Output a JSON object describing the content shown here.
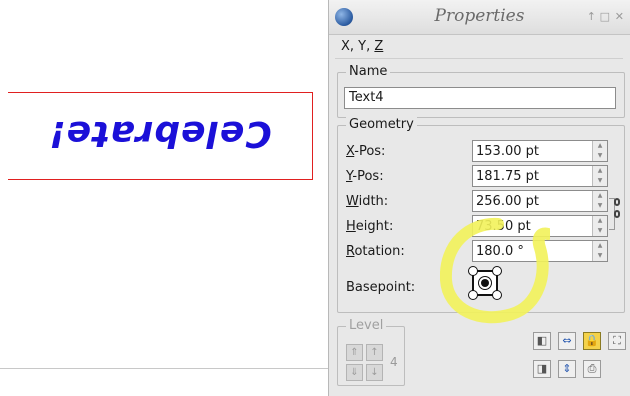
{
  "canvas": {
    "frame_text": "Celebrate!",
    "text_color": "#1b10d8",
    "frame_color": "#e02020"
  },
  "panel": {
    "title": "Properties",
    "window_buttons": {
      "up": "↑",
      "maximize": "□",
      "close": "✕"
    },
    "tab": {
      "prefix": "X, Y, ",
      "underlined": "Z"
    },
    "name_group": {
      "legend": "Name",
      "value": "Text4"
    },
    "geometry": {
      "legend": "Geometry",
      "rows": [
        {
          "mnemonic": "X",
          "rest": "-Pos:",
          "value": "153.00 pt"
        },
        {
          "mnemonic": "Y",
          "rest": "-Pos:",
          "value": "181.75 pt"
        },
        {
          "mnemonic": "W",
          "rest": "idth:",
          "value": "256.00 pt"
        },
        {
          "mnemonic": "H",
          "rest": "eight:",
          "value": "73.50 pt"
        },
        {
          "mnemonic": "R",
          "rest": "otation:",
          "value": "180.0 °"
        }
      ],
      "basepoint_label": "Basepoint:"
    },
    "level": {
      "legend": "Level",
      "value": "4"
    },
    "highlight_color": "#f2f25a"
  }
}
